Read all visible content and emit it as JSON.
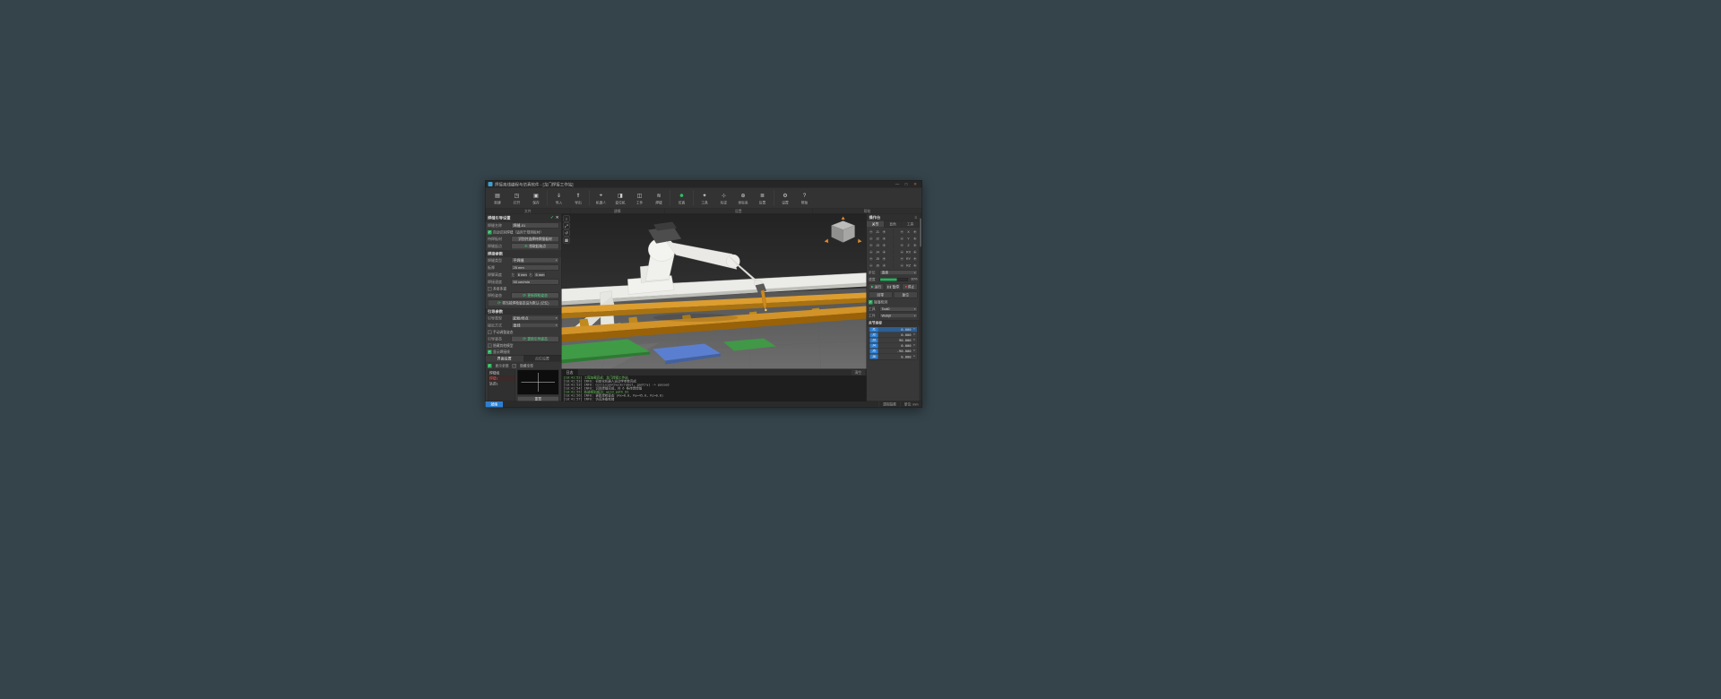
{
  "window": {
    "title": "焊接离线编程与仿真软件 - [龙门焊接工作站]",
    "min": "—",
    "max": "□",
    "close": "✕"
  },
  "glyphs": {
    "caret": "▾",
    "check": "✓",
    "refresh": "⟳",
    "pick": "✛",
    "play": "▶",
    "pause": "❚❚",
    "stop": "■",
    "minus": "−",
    "plus": "+",
    "menu": "≡"
  },
  "colors": {
    "accent_green": "#2fae60",
    "accent_blue": "#2f7fd1",
    "accent_red": "#d05050",
    "beam_orange": "#d59a2b"
  },
  "toolbar": {
    "items": [
      {
        "icon": "▤",
        "label": "新建"
      },
      {
        "icon": "◳",
        "label": "打开"
      },
      {
        "icon": "▣",
        "label": "保存"
      },
      {
        "icon": "⇓",
        "label": "导入"
      },
      {
        "icon": "⇑",
        "label": "导出"
      },
      {
        "icon": "⌖",
        "label": "机器人"
      },
      {
        "icon": "◨",
        "label": "变位机"
      },
      {
        "icon": "◫",
        "label": "工件"
      },
      {
        "icon": "≋",
        "label": "焊缝"
      },
      {
        "icon": "●",
        "label": "仿真"
      },
      {
        "icon": "✦",
        "label": "工具"
      },
      {
        "icon": "⊹",
        "label": "标定"
      },
      {
        "icon": "⊕",
        "label": "坐标系"
      },
      {
        "icon": "≣",
        "label": "后置"
      },
      {
        "icon": "⚙",
        "label": "设置"
      },
      {
        "icon": "?",
        "label": "帮助"
      }
    ],
    "groups": [
      "文件",
      "建模",
      "设置",
      "帮助"
    ]
  },
  "left_panel": {
    "title": "焊缝引导设置",
    "fields": {
      "name_label": "焊缝名称",
      "name_value": "焊缝-01",
      "auto_checkbox": "自动识别焊缝（适用于规则板材）",
      "plate_label": "待焊板材",
      "plate_button": "识别并选择待焊接板材",
      "start_label": "焊缝起点",
      "start_button": "拾取起始点"
    },
    "weld_section": {
      "title": "焊接参数",
      "type_label": "焊缝类型",
      "type_value": "平焊缝",
      "thick_label": "板厚",
      "thick_value": "25 mm",
      "leg_label": "焊脚高度",
      "leg_left_label": "左",
      "leg_left": "6 mm",
      "leg_right_label": "右",
      "leg_right": "6 mm",
      "speed_label": "焊接速度",
      "speed_value": "50 cm/min",
      "multi_checkbox": "多层多道",
      "pose_label": "焊枪姿态",
      "pose_button": "更新焊枪姿态",
      "memory_button": "将当前焊枪姿态设为默认 (记忆)"
    },
    "guide_section": {
      "title": "引导参数",
      "type_label": "引导类型",
      "type_value": "起始/终点",
      "approach_label": "接近方式",
      "approach_value": "直线",
      "manual_checkbox": "手动调整姿态",
      "pose_label": "引导姿态",
      "pose_button": "更新引导姿态",
      "hide_checkbox": "隐藏其他模型",
      "showline_checkbox": "显示焊接线"
    },
    "bottom": {
      "tab_active": "界面设置",
      "tab_inactive": "点位设置",
      "show_all": "显示全部",
      "hide_all": "隐藏全部",
      "items": [
        {
          "label": "焊缝组"
        },
        {
          "label": "焊缝1"
        },
        {
          "label": "轨迹1"
        }
      ],
      "reset_button": "重置"
    }
  },
  "viewport": {
    "tools": [
      {
        "icon": "⌂"
      },
      {
        "icon": "⤢"
      },
      {
        "icon": "↺"
      },
      {
        "icon": "▦"
      }
    ]
  },
  "right_panel": {
    "title": "操作台",
    "tabs": [
      "关节",
      "直角",
      "工具"
    ],
    "jog_rows": [
      {
        "l": "J1",
        "r": "X"
      },
      {
        "l": "J2",
        "r": "Y"
      },
      {
        "l": "J3",
        "r": "Z"
      },
      {
        "l": "J4",
        "r": "RX"
      },
      {
        "l": "J5",
        "r": "RY"
      },
      {
        "l": "J6",
        "r": "RZ"
      }
    ],
    "step_label": "步长",
    "step_value": "连续",
    "speed_label": "速度",
    "speed_value": "60%",
    "run_label": "运行",
    "pause_label": "暂停",
    "stop_label": "停止",
    "home_label": "回零",
    "reset_label": "复位",
    "collision_checkbox": "碰撞检测",
    "tool_label": "工具",
    "tool_value": "Tool0",
    "wobj_label": "工件",
    "wobj_value": "Wobj0",
    "table_title": "关节坐标",
    "axis_table": [
      {
        "axis": "J1",
        "value": "0.000 °"
      },
      {
        "axis": "J2",
        "value": "0.000 °"
      },
      {
        "axis": "J3",
        "value": "90.000 °"
      },
      {
        "axis": "J4",
        "value": "0.000 °"
      },
      {
        "axis": "J5",
        "value": "-90.000 °"
      },
      {
        "axis": "J6",
        "value": "0.000 °"
      }
    ]
  },
  "log": {
    "tab": "日志",
    "clear_button": "清空",
    "lines": [
      {
        "text": "[10:41:52] 工程加载完成：龙门焊接工作站"
      },
      {
        "text": "[10:41:53] INFO: 初始化机器人运动学参数完成"
      },
      {
        "text": "[10:41:53] INFO: CollisionCheck(robot, gantry) -> passed"
      },
      {
        "text": "[10:41:54] INFO: 识别焊缝完成，共 6 条待焊焊缝"
      },
      {
        "text": "[10:41:55] 轨迹规划成功：weld_path_01"
      },
      {
        "text": "[10:41:56] INFO: 更新焊枪姿态 (Rx=0.0, Ry=45.0, Rz=0.0)"
      },
      {
        "text": "[10:41:57] INFO: 仿真准备就绪"
      }
    ]
  },
  "status_bar": {
    "left": "就绪",
    "right_items": [
      "透视投影",
      "单位: mm"
    ]
  }
}
